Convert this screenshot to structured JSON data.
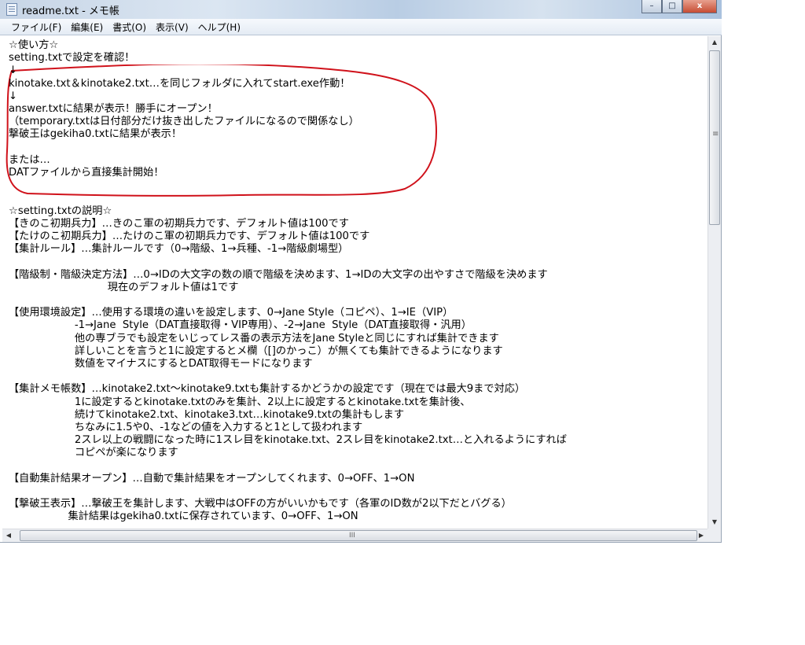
{
  "window": {
    "title": "readme.txt - メモ帳",
    "minimize": "–",
    "maximize": "□",
    "close": "x"
  },
  "menu": [
    "ファイル(F)",
    "編集(E)",
    "書式(O)",
    "表示(V)",
    "ヘルプ(H)"
  ],
  "editor": {
    "lines": [
      "☆使い方☆",
      "setting.txtで設定を確認！",
      "↓",
      "kinotake.txt＆kinotake2.txt…を同じフォルダに入れてstart.exe作動！",
      "↓",
      "answer.txtに結果が表示！勝手にオープン！",
      "（temporary.txtは日付部分だけ抜き出したファイルになるので関係なし）",
      "撃破王はgekiha0.txtに結果が表示！",
      "",
      "または…",
      "DATファイルから直接集計開始！",
      "",
      "",
      "☆setting.txtの説明☆",
      "【きのこ初期兵力】…きのこ軍の初期兵力です、デフォルト値は100です",
      "【たけのこ初期兵力】…たけのこ軍の初期兵力です、デフォルト値は100です",
      "【集計ルール】…集計ルールです（0→階級、1→兵種、-1→階級劇場型）",
      "",
      "【階級制・階級決定方法】…0→IDの大文字の数の順で階級を決めます、1→IDの大文字の出やすさで階級を決めます",
      "                              現在のデフォルト値は1です",
      "",
      "【使用環境設定】…使用する環境の違いを設定します、0→Jane Style（コピペ）、1→IE（VIP）",
      "                    -1→Jane  Style（DAT直接取得・VIP専用）、-2→Jane  Style（DAT直接取得・汎用）",
      "                    他の専ブラでも設定をいじってレス番の表示方法をJane Styleと同じにすれば集計できます",
      "                    詳しいことを言うと1に設定するとメ欄（[]のかっこ）が無くても集計できるようになります",
      "                    数値をマイナスにするとDAT取得モードになります",
      "",
      "【集計メモ帳数】…kinotake2.txt～kinotake9.txtも集計するかどうかの設定です（現在では最大9まで対応）",
      "                    1に設定するとkinotake.txtのみを集計、2以上に設定するとkinotake.txtを集計後、",
      "                    続けてkinotake2.txt、kinotake3.txt…kinotake9.txtの集計もします",
      "                    ちなみに1.5や0、-1などの値を入力すると1として扱われます",
      "                    2スレ以上の戦闘になった時に1スレ目をkinotake.txt、2スレ目をkinotake2.txt…と入れるようにすれば",
      "                    コピペが楽になります",
      "",
      "【自動集計結果オープン】…自動で集計結果をオープンしてくれます、0→OFF、1→ON",
      "",
      "【撃破王表示】…撃破王を集計します、大戦中はOFFの方がいいかもです（各軍のID数が2以下だとバグる）",
      "                  集計結果はgekiha0.txtに保存されています、0→OFF、1→ON"
    ]
  },
  "annotation_color": "#d0121b"
}
